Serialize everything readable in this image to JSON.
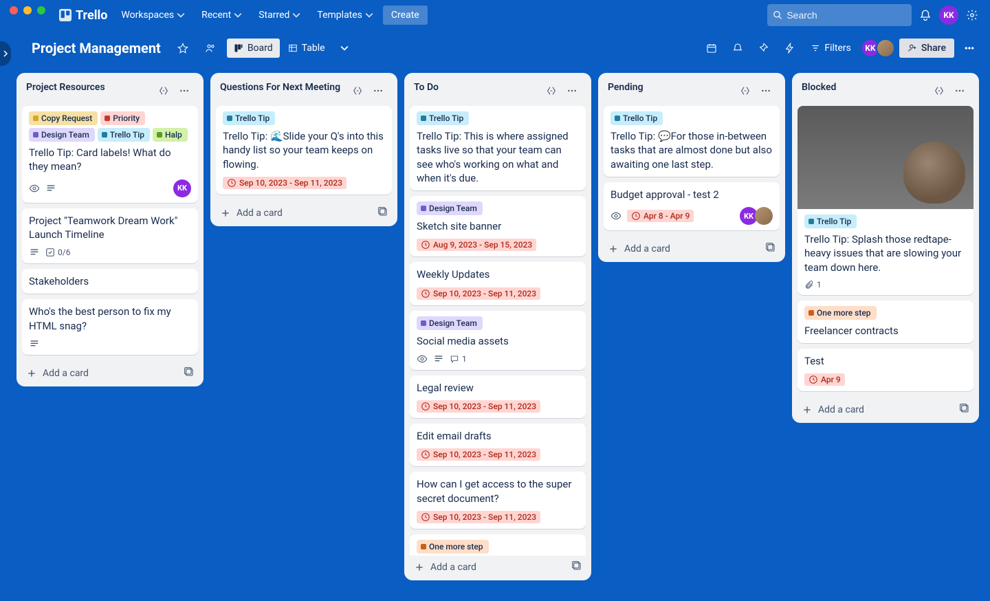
{
  "nav": {
    "brand": "Trello",
    "workspaces": "Workspaces",
    "recent": "Recent",
    "starred": "Starred",
    "templates": "Templates",
    "create": "Create",
    "search_placeholder": "Search"
  },
  "board": {
    "title": "Project Management",
    "view_board": "Board",
    "view_table": "Table",
    "filters": "Filters",
    "share": "Share"
  },
  "add_card_label": "Add a card",
  "labels": {
    "copy_request": "Copy Request",
    "priority": "Priority",
    "design_team": "Design Team",
    "trello_tip": "Trello Tip",
    "halp": "Halp",
    "one_more_step": "One more step"
  },
  "lists": [
    {
      "title": "Project Resources",
      "cards": [
        {
          "labels": [
            "copy_request",
            "priority",
            "design_team",
            "trello_tip",
            "halp"
          ],
          "title": "Trello Tip: Card labels! What do they mean?",
          "badges": {
            "watch": true,
            "desc": true,
            "members": [
              "KK"
            ]
          }
        },
        {
          "title": "Project \"Teamwork Dream Work\" Launch Timeline",
          "badges": {
            "desc": true,
            "checklist": "0/6"
          }
        },
        {
          "title": "Stakeholders"
        },
        {
          "title": "Who's the best person to fix my HTML snag?",
          "badges": {
            "desc": true
          }
        }
      ]
    },
    {
      "title": "Questions For Next Meeting",
      "cards": [
        {
          "labels": [
            "trello_tip"
          ],
          "title": "Trello Tip: 🌊Slide your Q's into this handy list so your team keeps on flowing.",
          "badges": {
            "date": "Sep 10, 2023 - Sep 11, 2023"
          }
        }
      ]
    },
    {
      "title": "To Do",
      "cards": [
        {
          "labels": [
            "trello_tip"
          ],
          "title": "Trello Tip: This is where assigned tasks live so that your team can see who's working on what and when it's due."
        },
        {
          "labels": [
            "design_team"
          ],
          "title": "Sketch site banner",
          "badges": {
            "date": "Aug 9, 2023 - Sep 15, 2023"
          }
        },
        {
          "title": "Weekly Updates",
          "badges": {
            "date": "Sep 10, 2023 - Sep 11, 2023"
          }
        },
        {
          "labels": [
            "design_team"
          ],
          "title": "Social media assets",
          "badges": {
            "watch": true,
            "desc": true,
            "comments": "1"
          }
        },
        {
          "title": "Legal review",
          "badges": {
            "date": "Sep 10, 2023 - Sep 11, 2023"
          }
        },
        {
          "title": "Edit email drafts",
          "badges": {
            "date": "Sep 10, 2023 - Sep 11, 2023"
          }
        },
        {
          "title": "How can I get access to the super secret document?",
          "badges": {
            "date": "Sep 10, 2023 - Sep 11, 2023"
          }
        },
        {
          "labels": [
            "one_more_step"
          ],
          "title": ""
        }
      ]
    },
    {
      "title": "Pending",
      "cards": [
        {
          "labels": [
            "trello_tip"
          ],
          "title": "Trello Tip: 💬For those in-between tasks that are almost done but also awaiting one last step."
        },
        {
          "title": "Budget approval - test 2",
          "badges": {
            "watch": true,
            "date": "Apr 8 - Apr 9",
            "members": [
              "KK",
              "photo"
            ]
          }
        }
      ]
    },
    {
      "title": "Blocked",
      "cards": [
        {
          "cover": true,
          "labels": [
            "trello_tip"
          ],
          "title": "Trello Tip: Splash those redtape-heavy issues that are slowing your team down here.",
          "badges": {
            "attach": "1"
          }
        },
        {
          "labels": [
            "one_more_step"
          ],
          "title": "Freelancer contracts"
        },
        {
          "title": "Test",
          "badges": {
            "date": "Apr 9"
          }
        }
      ]
    }
  ]
}
